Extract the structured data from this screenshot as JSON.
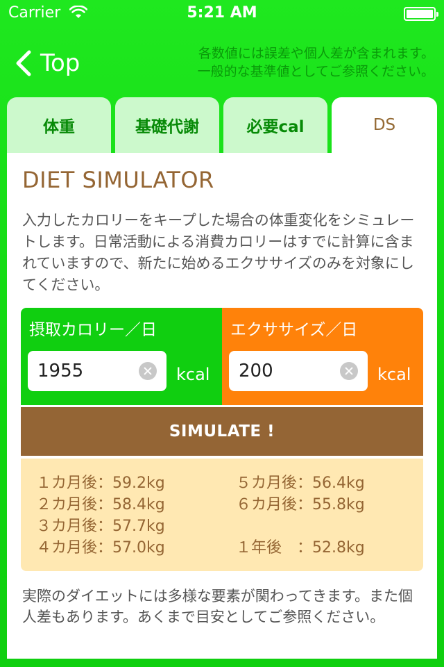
{
  "status_bar": {
    "carrier": "Carrier",
    "time": "5:21 AM"
  },
  "nav": {
    "back_label": "Top",
    "notice_line1": "各数値には誤差や個人差が含まれます。",
    "notice_line2": "一般的な基準値としてご参照ください。"
  },
  "tabs": [
    {
      "label": "体重",
      "active": false
    },
    {
      "label": "基礎代謝",
      "active": false
    },
    {
      "label": "必要cal",
      "active": false
    },
    {
      "label": "DS",
      "active": true
    }
  ],
  "content": {
    "title": "DIET SIMULATOR",
    "description": "入力したカロリーをキープした場合の体重変化をシミュレートします。日常活動による消費カロリーはすでに計算に含まれていますので、新たに始めるエクササイズのみを対象にしてください。",
    "intake": {
      "label": "摂取カロリー／日",
      "value": "1955",
      "unit": "kcal"
    },
    "exercise": {
      "label": "エクササイズ／日",
      "value": "200",
      "unit": "kcal"
    },
    "simulate_label": "SIMULATE !",
    "results_left": [
      "１カ月後：59.2kg",
      "２カ月後：58.4kg",
      "３カ月後：57.7kg",
      "４カ月後：57.0kg"
    ],
    "results_right": [
      "５カ月後：56.4kg",
      "６カ月後：55.8kg",
      "",
      "１年後　：52.8kg"
    ],
    "footer_note": "実際のダイエットには多様な要素が関わってきます。また個人差もあります。あくまで目安としてご参照ください。"
  },
  "colors": {
    "background": "#10d610",
    "accent_brown": "#946533",
    "exercise_orange": "#ff820a",
    "result_bg": "#ffe8b2",
    "tab_inactive": "#ccf9cc"
  }
}
